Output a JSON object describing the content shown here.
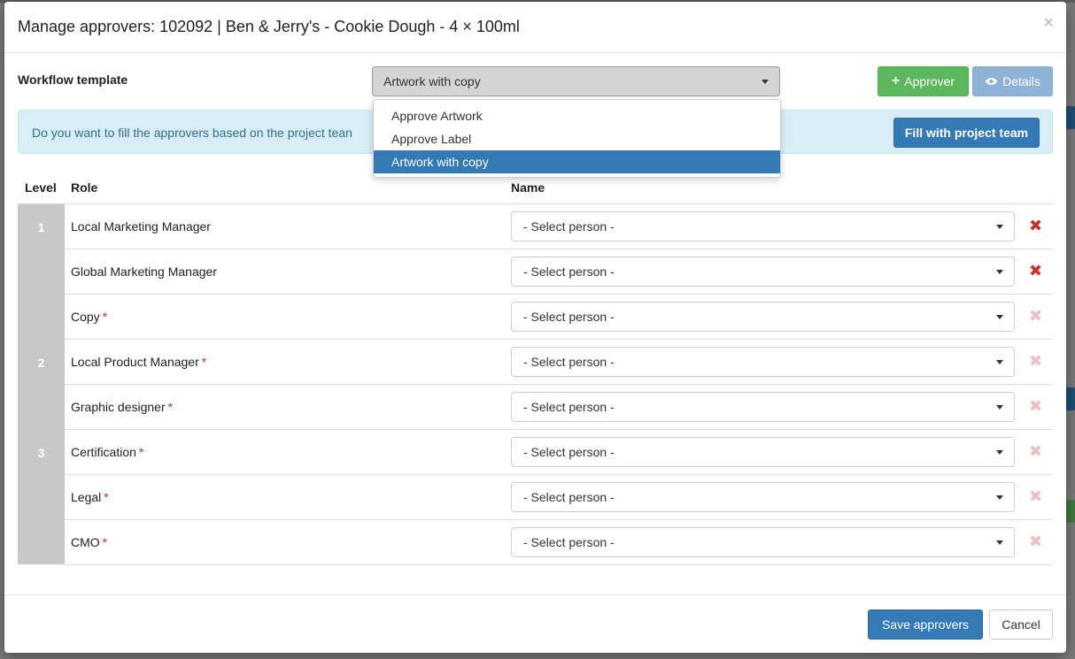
{
  "modal": {
    "title": "Manage approvers: 102092 | Ben & Jerry's - Cookie Dough - 4 × 100ml",
    "close_glyph": "×"
  },
  "workflow": {
    "label": "Workflow template",
    "selected": "Artwork with copy",
    "options": [
      "Approve Artwork",
      "Approve Label",
      "Artwork with copy"
    ]
  },
  "buttons": {
    "add_approver_icon": "+",
    "add_approver": "Approver",
    "details_icon": "👁",
    "details": "Details",
    "fill_team": "Fill with project team",
    "save": "Save approvers",
    "cancel": "Cancel"
  },
  "alert": {
    "text": "Do you want to fill the approvers based on the project tean"
  },
  "table": {
    "headers": {
      "level": "Level",
      "role": "Role",
      "name": "Name"
    },
    "levels": [
      "1",
      "2",
      "3"
    ],
    "rows": [
      {
        "role": "Local Marketing Manager",
        "required": "",
        "person": "- Select person -",
        "remove_active": true
      },
      {
        "role": "Global Marketing Manager",
        "required": "",
        "person": "- Select person -",
        "remove_active": true
      },
      {
        "role": "Copy",
        "required": "*",
        "person": "- Select person -",
        "remove_active": false
      },
      {
        "role": "Local Product Manager",
        "required": "*",
        "person": "- Select person -",
        "remove_active": false
      },
      {
        "role": "Graphic designer",
        "required": "*",
        "person": "- Select person -",
        "remove_active": false
      },
      {
        "role": "Certification",
        "required": "*",
        "person": "- Select person -",
        "remove_active": false
      },
      {
        "role": "Legal",
        "required": "*",
        "person": "- Select person -",
        "remove_active": false
      },
      {
        "role": "CMO",
        "required": "*",
        "person": "- Select person -",
        "remove_active": false
      }
    ],
    "remove_glyph": "✖"
  },
  "colors": {
    "primary": "#337ab7",
    "success": "#5cb85c",
    "info_bg": "#d9edf7",
    "info_text": "#31708f",
    "danger_active": "#c9302c",
    "danger_muted": "#ecc0c0",
    "level_bg": "#c8c8c8"
  }
}
